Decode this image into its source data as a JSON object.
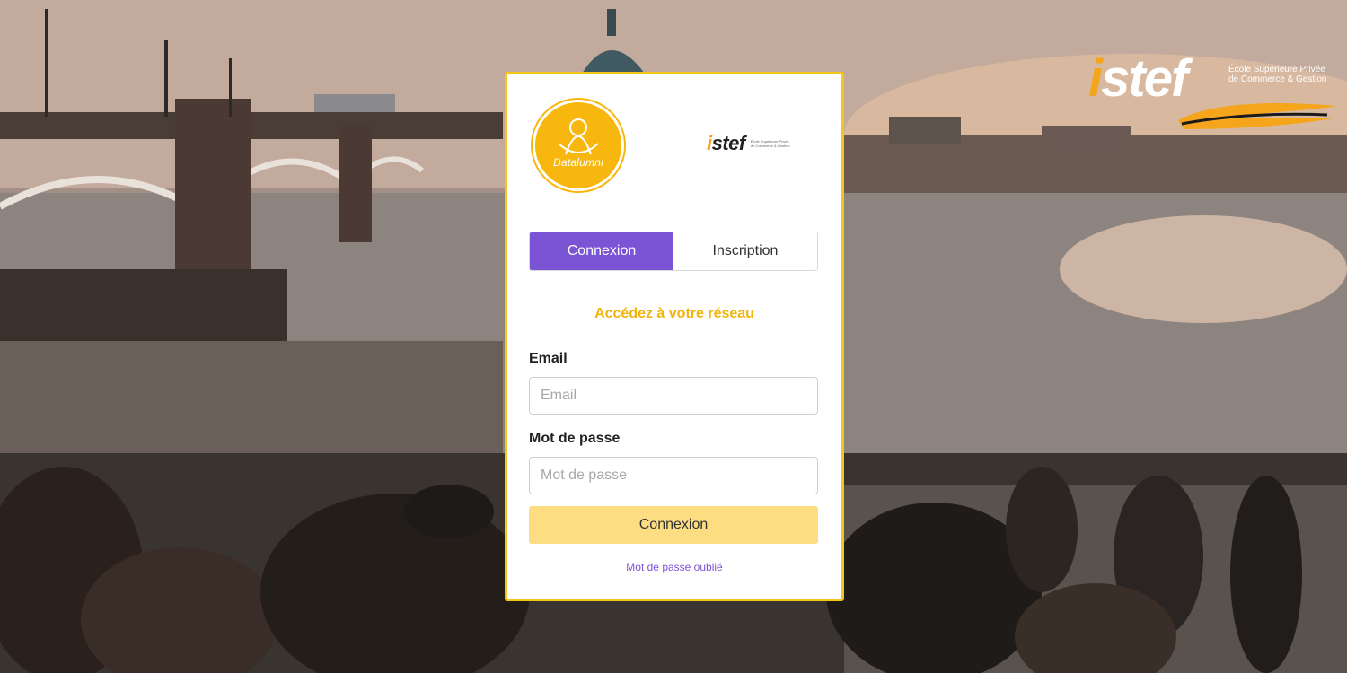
{
  "background": {
    "brand_logo_text": "istef",
    "brand_tagline": "École Supérieure Privée de Commerce & Gestion"
  },
  "card": {
    "app_logo_text": "Datalumni",
    "partner_logo_text": "istef",
    "partner_tagline": "École Supérieure Privée de Commerce & Gestion",
    "tabs": [
      {
        "label": "Connexion",
        "active": true
      },
      {
        "label": "Inscription",
        "active": false
      }
    ],
    "subtitle": "Accédez à votre réseau",
    "email": {
      "label": "Email",
      "placeholder": "Email",
      "value": ""
    },
    "password": {
      "label": "Mot de passe",
      "placeholder": "Mot de passe",
      "value": ""
    },
    "submit_label": "Connexion",
    "forgot_label": "Mot de passe oublié"
  },
  "colors": {
    "accent_purple": "#7b54d6",
    "accent_yellow": "#f5c518",
    "button_yellow": "#fcdd82",
    "logo_orange": "#f8b70f"
  }
}
